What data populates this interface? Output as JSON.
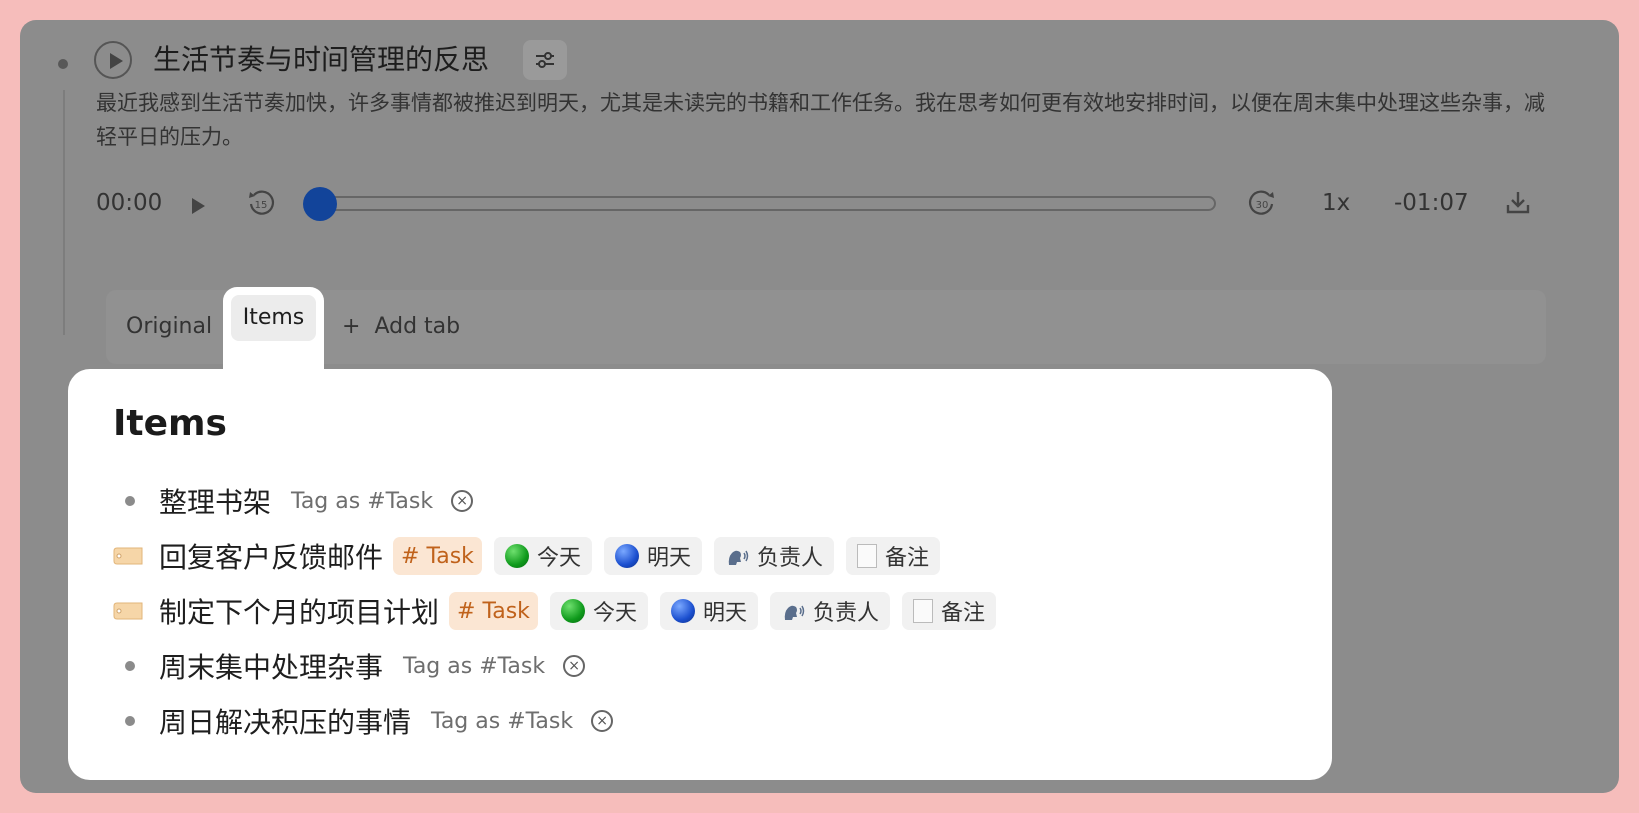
{
  "note": {
    "title": "生活节奏与时间管理的反思",
    "summary": "最近我感到生活节奏加快，许多事情都被推迟到明天，尤其是未读完的书籍和工作任务。我在思考如何更有效地安排时间，以便在周末集中处理这些杂事，减轻平日的压力。"
  },
  "player": {
    "current_time": "00:00",
    "rate": "1x",
    "remaining": "-01:07",
    "progress": 0
  },
  "tabs": {
    "original": "Original",
    "items": "Items",
    "add": "Add tab",
    "add_plus": "+"
  },
  "panel": {
    "title": "Items",
    "rows": [
      {
        "text": "整理书架",
        "tag_action": "Tag as #Task"
      },
      {
        "text": "回复客户反馈邮件",
        "task": "# Task",
        "today": "今天",
        "tomorrow": "明天",
        "owner": "负责人",
        "note": "备注"
      },
      {
        "text": "制定下个月的项目计划",
        "task": "# Task",
        "today": "今天",
        "tomorrow": "明天",
        "owner": "负责人",
        "note": "备注"
      },
      {
        "text": "周末集中处理杂事",
        "tag_action": "Tag as #Task"
      },
      {
        "text": "周日解决积压的事情",
        "tag_action": "Tag as #Task"
      }
    ]
  },
  "colors": {
    "accent": "#12449a",
    "task_chip": "#fbe6d3",
    "background": "#f6bdbb"
  }
}
